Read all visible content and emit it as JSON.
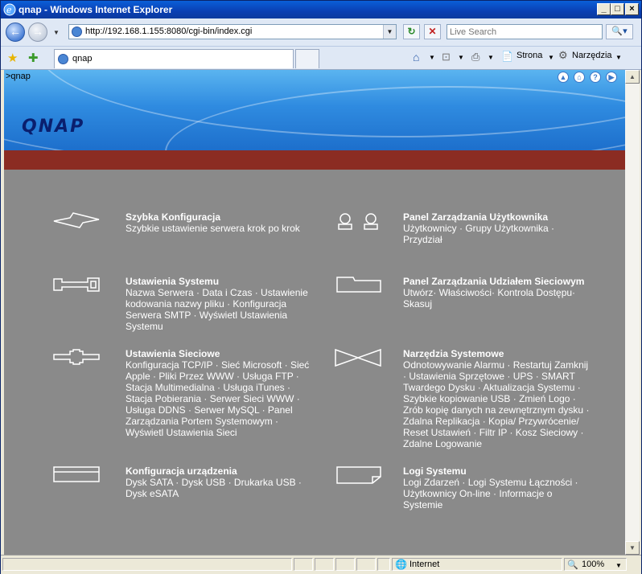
{
  "window": {
    "title": "qnap - Windows Internet Explorer"
  },
  "address": {
    "url": "http://192.168.1.155:8080/cgi-bin/index.cgi",
    "search_placeholder": "Live Search"
  },
  "tab": {
    "label": "qnap"
  },
  "commands": {
    "page": "Strona",
    "tools": "Narzędzia"
  },
  "page": {
    "breadcrumb": ">qnap",
    "logo": "QNAP",
    "sections": [
      {
        "title": "Szybka Konfiguracja",
        "desc": "Szybkie ustawienie serwera krok po krok",
        "icon": "lightning-icon"
      },
      {
        "title": "Panel Zarządzania Użytkownika",
        "desc": "Użytkownicy · Grupy Użytkownika · Przydział",
        "icon": "users-icon"
      },
      {
        "title": "Ustawienia Systemu",
        "desc": "Nazwa Serwera · Data i Czas · Ustawienie kodowania nazwy pliku · Konfiguracja Serwera SMTP · Wyświetl Ustawienia Systemu",
        "icon": "key-icon"
      },
      {
        "title": "Panel Zarządzania Udziałem Sieciowym",
        "desc": "Utwórz· Właściwości· Kontrola Dostępu· Skasuj",
        "icon": "folder-icon"
      },
      {
        "title": "Ustawienia Sieciowe",
        "desc": "Konfiguracja TCP/IP · Sieć Microsoft · Sieć Apple · Pliki Przez WWW · Usługa FTP · Stacja Multimedialna · Usługa iTunes · Stacja Pobierania · Serwer Sieci WWW · Usługa DDNS · Serwer MySQL · Panel Zarządzania Portem Systemowym · Wyświetl Ustawienia Sieci",
        "icon": "network-icon"
      },
      {
        "title": "Narzędzia Systemowe",
        "desc": "Odnotowywanie Alarmu · Restartuj Zamknij · Ustawienia Sprzętowe · UPS · SMART Twardego Dysku · Aktualizacja Systemu · Szybkie kopiowanie USB · Zmień Logo · Zrób kopię danych na zewnętrznym dysku · Zdalna Replikacja · Kopia/ Przywrócenie/ Reset Ustawień · Filtr IP · Kosz Sieciowy · Zdalne Logowanie",
        "icon": "bowtie-icon"
      },
      {
        "title": "Konfiguracja urządzenia",
        "desc": "Dysk SATA · Dysk USB · Drukarka USB · Dysk eSATA",
        "icon": "drive-icon"
      },
      {
        "title": "Logi Systemu",
        "desc": "Logi Zdarzeń · Logi Systemu Łączności · Użytkownicy On-line · Informacje o Systemie",
        "icon": "log-icon"
      }
    ]
  },
  "status": {
    "zone": "Internet",
    "zoom": "100%"
  }
}
